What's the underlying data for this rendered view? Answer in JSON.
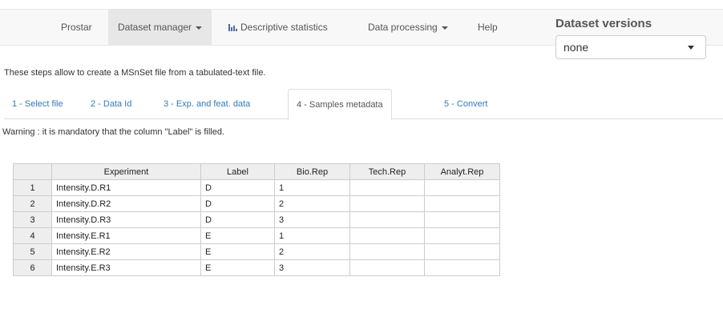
{
  "navbar": {
    "items": [
      {
        "label": "Prostar"
      },
      {
        "label": "Dataset manager"
      },
      {
        "label": "Descriptive statistics",
        "icon": "bar-chart-icon"
      },
      {
        "label": "Data processing"
      },
      {
        "label": "Help"
      }
    ],
    "active_index": 1
  },
  "versions": {
    "title": "Dataset versions",
    "selected": "none"
  },
  "intro_text": "These steps allow to create a MSnSet file from a tabulated-text file.",
  "tabs": [
    {
      "label": "1 - Select file"
    },
    {
      "label": "2 - Data Id"
    },
    {
      "label": "3 - Exp. and feat. data"
    },
    {
      "label": "4 - Samples metadata"
    },
    {
      "label": "5 - Convert"
    }
  ],
  "active_tab_index": 3,
  "warning_text": "Warning : it is mandatory that the column \"Label\" is filled.",
  "table": {
    "headers": [
      "",
      "Experiment",
      "Label",
      "Bio.Rep",
      "Tech.Rep",
      "Analyt.Rep"
    ],
    "rows": [
      [
        "1",
        "Intensity.D.R1",
        "D",
        "1",
        "",
        ""
      ],
      [
        "2",
        "Intensity.D.R2",
        "D",
        "2",
        "",
        ""
      ],
      [
        "3",
        "Intensity.D.R3",
        "D",
        "3",
        "",
        ""
      ],
      [
        "4",
        "Intensity.E.R1",
        "E",
        "1",
        "",
        ""
      ],
      [
        "5",
        "Intensity.E.R2",
        "E",
        "2",
        "",
        ""
      ],
      [
        "6",
        "Intensity.E.R3",
        "E",
        "3",
        "",
        ""
      ]
    ]
  },
  "colors": {
    "navbar_bg": "#f8f8f8",
    "active_nav": "#e7e7e7",
    "link": "#337ab7",
    "header_cell": "#eeeeee"
  }
}
